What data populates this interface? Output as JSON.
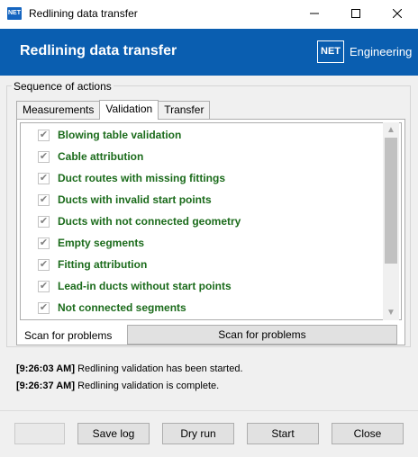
{
  "window": {
    "title": "Redlining data transfer",
    "app_icon_text": "NET",
    "controls": [
      "minimize-icon",
      "maximize-icon",
      "close-icon"
    ]
  },
  "banner": {
    "title": "Redlining data transfer",
    "logo_box": "NET",
    "logo_text": "Engineering",
    "background": "#0a5eb0"
  },
  "group": {
    "label": "Sequence of actions"
  },
  "tabs": [
    {
      "label": "Measurements",
      "active": false
    },
    {
      "label": "Validation",
      "active": true
    },
    {
      "label": "Transfer",
      "active": false
    }
  ],
  "validation_items": [
    {
      "label": "Blowing table validation",
      "checked": true
    },
    {
      "label": "Cable attribution",
      "checked": true
    },
    {
      "label": "Duct routes with missing fittings",
      "checked": true
    },
    {
      "label": "Ducts with invalid start points",
      "checked": true
    },
    {
      "label": "Ducts with not connected geometry",
      "checked": true
    },
    {
      "label": "Empty segments",
      "checked": true
    },
    {
      "label": "Fitting attribution",
      "checked": true
    },
    {
      "label": "Lead-in ducts without start points",
      "checked": true
    },
    {
      "label": "Not connected segments",
      "checked": true
    }
  ],
  "item_color": "#1b6b1b",
  "scan": {
    "label": "Scan for problems",
    "button": "Scan for problems"
  },
  "log": [
    {
      "time": "[9:26:03 AM]",
      "message": "Redlining validation has been started."
    },
    {
      "time": "[9:26:37 AM]",
      "message": "Redlining validation is complete."
    }
  ],
  "footer": {
    "save_log": "Save log",
    "dry_run": "Dry run",
    "start": "Start",
    "close": "Close"
  }
}
